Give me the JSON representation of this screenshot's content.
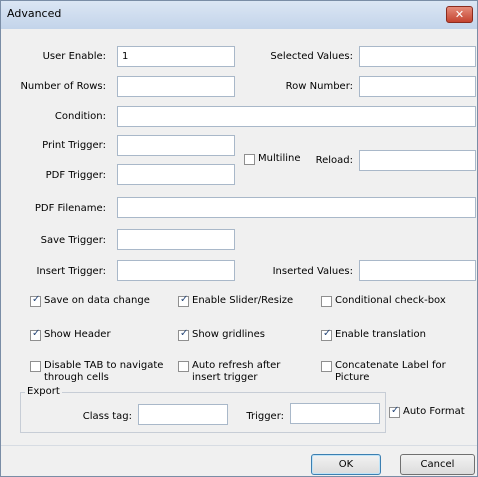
{
  "window": {
    "title": "Advanced",
    "close_glyph": "✕"
  },
  "fields": {
    "user_enable": {
      "label": "User Enable:",
      "value": "1"
    },
    "selected_values": {
      "label": "Selected Values:",
      "value": ""
    },
    "number_of_rows": {
      "label": "Number of Rows:",
      "value": ""
    },
    "row_number": {
      "label": "Row Number:",
      "value": ""
    },
    "condition": {
      "label": "Condition:",
      "value": ""
    },
    "print_trigger": {
      "label": "Print Trigger:",
      "value": ""
    },
    "pdf_trigger": {
      "label": "PDF Trigger:",
      "value": ""
    },
    "reload": {
      "label": "Reload:",
      "value": ""
    },
    "pdf_filename": {
      "label": "PDF Filename:",
      "value": ""
    },
    "save_trigger": {
      "label": "Save Trigger:",
      "value": ""
    },
    "insert_trigger": {
      "label": "Insert Trigger:",
      "value": ""
    },
    "inserted_values": {
      "label": "Inserted Values:",
      "value": ""
    }
  },
  "multiline": {
    "label": "Multiline",
    "checked": false
  },
  "options": [
    {
      "label": "Save on data change",
      "checked": true
    },
    {
      "label": "Enable Slider/Resize",
      "checked": true
    },
    {
      "label": "Conditional check-box",
      "checked": false
    },
    {
      "label": "Show Header",
      "checked": true
    },
    {
      "label": "Show gridlines",
      "checked": true
    },
    {
      "label": "Enable translation",
      "checked": true
    },
    {
      "label": "Disable TAB to navigate through cells",
      "line1": "Disable TAB to navigate",
      "line2": "through cells",
      "checked": false
    },
    {
      "label": "Auto refresh after insert trigger",
      "line1": "Auto refresh after",
      "line2": "insert trigger",
      "checked": false
    },
    {
      "label": "Concatenate Label for Picture",
      "line1": "Concatenate Label for",
      "line2": "Picture",
      "checked": false
    }
  ],
  "export": {
    "title": "Export",
    "class_tag": {
      "label": "Class tag:",
      "value": ""
    },
    "trigger": {
      "label": "Trigger:",
      "value": ""
    },
    "auto_format": {
      "label": "Auto Format",
      "checked": true
    }
  },
  "buttons": {
    "ok": "OK",
    "cancel": "Cancel"
  }
}
